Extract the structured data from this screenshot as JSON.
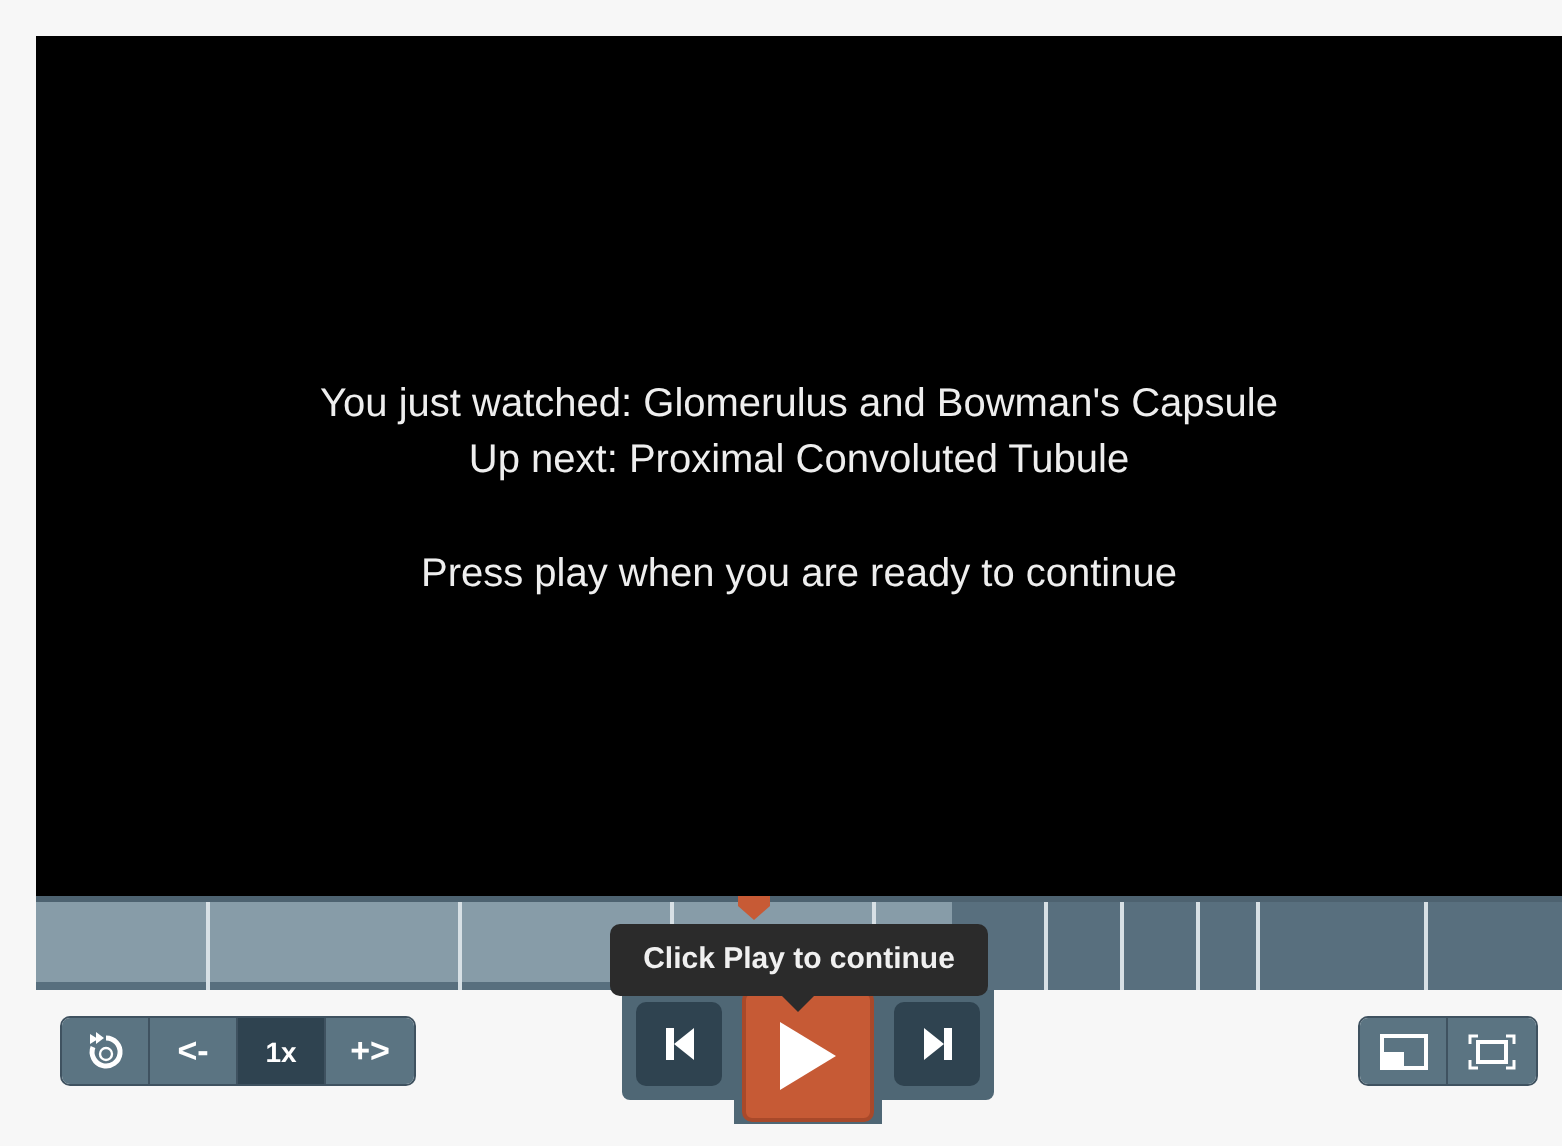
{
  "video": {
    "lines": [
      {
        "text": "You just watched: Glomerulus and Bowman's Capsule"
      },
      {
        "text": "Up next: Proximal Convoluted Tubule"
      },
      {
        "text": "Press play when you are ready to continue",
        "gap": true
      }
    ]
  },
  "timeline": {
    "level": 0.47,
    "buffered": {
      "level": 0.6
    }
  },
  "tooltip": "Click Play to continue",
  "speed": "1x",
  "slower": "<-",
  "faster": "+>"
}
